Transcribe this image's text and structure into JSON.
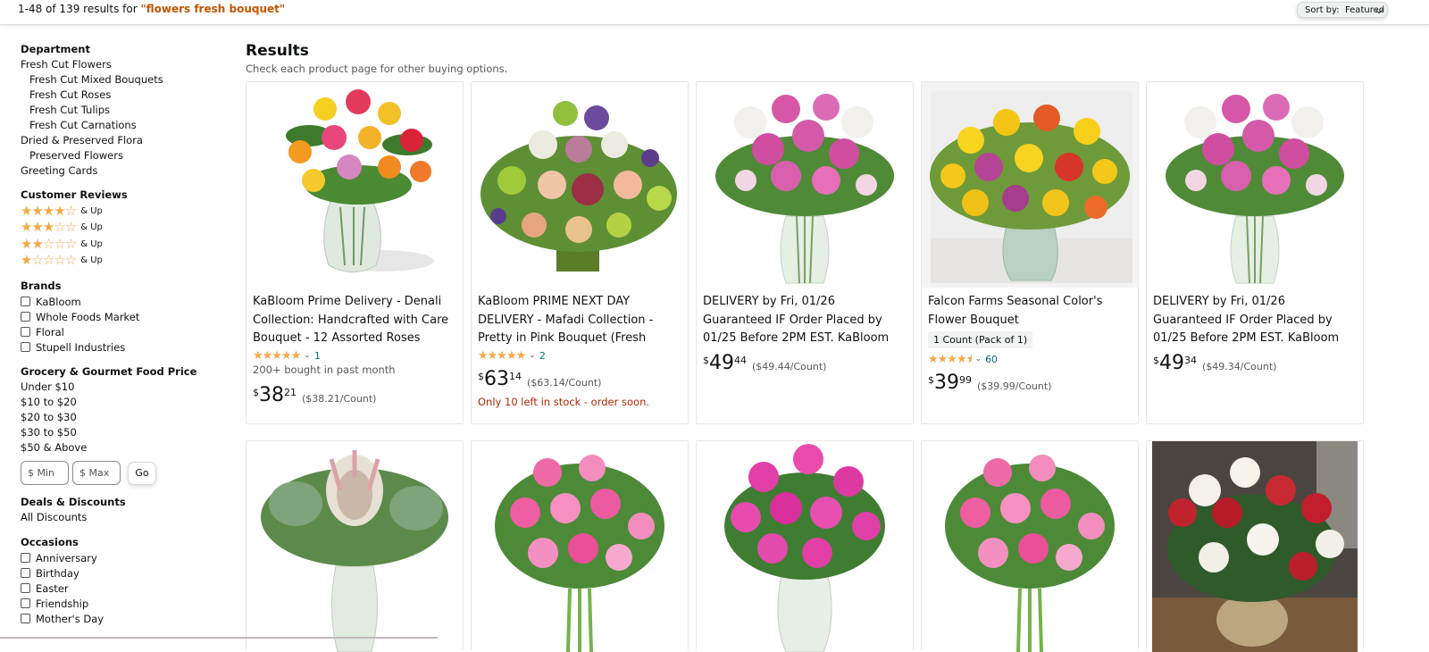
{
  "header": {
    "result_range": "1-48 of 139 results for ",
    "query": "\"flowers fresh bouquet\"",
    "sort_label": "Sort by:",
    "sort_value": "Featured"
  },
  "sidebar": {
    "department": {
      "heading": "Department",
      "items": [
        "Fresh Cut Flowers",
        "Fresh Cut Mixed Bouquets",
        "Fresh Cut Roses",
        "Fresh Cut Tulips",
        "Fresh Cut Carnations",
        "Dried & Preserved Flora",
        "Preserved Flowers",
        "Greeting Cards"
      ]
    },
    "reviews": {
      "heading": "Customer Reviews",
      "and_up": "& Up"
    },
    "brands": {
      "heading": "Brands",
      "items": [
        "KaBloom",
        "Whole Foods Market",
        "Floral",
        "Stupell Industries"
      ]
    },
    "price": {
      "heading": "Grocery & Gourmet Food Price",
      "items": [
        "Under $10",
        "$10 to $20",
        "$20 to $30",
        "$30 to $50",
        "$50 & Above"
      ],
      "min_placeholder": "$ Min",
      "max_placeholder": "$ Max",
      "go_label": "Go"
    },
    "deals": {
      "heading": "Deals & Discounts",
      "items": [
        "All Discounts"
      ]
    },
    "occasions": {
      "heading": "Occasions",
      "items": [
        "Anniversary",
        "Birthday",
        "Easter",
        "Friendship",
        "Mother's Day"
      ]
    }
  },
  "main": {
    "title": "Results",
    "subtitle": "Check each product page for other buying options.",
    "products": [
      {
        "title": "KaBloom Prime Delivery - Denali Collection: Handcrafted with Care Bouquet - 12 Assorted Roses and…",
        "rating_count": "1",
        "bought": "200+ bought in past month",
        "price_symbol": "$",
        "price_whole": "38",
        "price_fraction": "21",
        "unit_price": "($38.21/Count)"
      },
      {
        "title": "KaBloom PRIME NEXT DAY DELIVERY - Mafadi Collection - Pretty in Pink Bouquet (Fresh Flowers For Delivery…",
        "rating_count": "2",
        "price_symbol": "$",
        "price_whole": "63",
        "price_fraction": "14",
        "unit_price": "($63.14/Count)",
        "stock": "Only 10 left in stock - order soon."
      },
      {
        "title": "DELIVERY by Fri, 01/26 Guaranteed IF Order Placed by 01/25 Before 2PM EST. KaBloom Valentine's PRIME…",
        "price_symbol": "$",
        "price_whole": "49",
        "price_fraction": "44",
        "unit_price": "($49.44/Count)"
      },
      {
        "title": "Falcon Farms Seasonal Color's Flower Bouquet",
        "pack": "1 Count (Pack of 1)",
        "rating_count": "60",
        "price_symbol": "$",
        "price_whole": "39",
        "price_fraction": "99",
        "unit_price": "($39.99/Count)"
      },
      {
        "title": "DELIVERY by Fri, 01/26 Guaranteed IF Order Placed by 01/25 Before 2PM EST. KaBloom Valentine's PRIME…",
        "price_symbol": "$",
        "price_whole": "49",
        "price_fraction": "34",
        "unit_price": "($49.34/Count)"
      }
    ]
  },
  "colors": {
    "accent_orange": "#c45500",
    "star": "#f3a847",
    "link": "#007185",
    "stock_red": "#b12704"
  }
}
